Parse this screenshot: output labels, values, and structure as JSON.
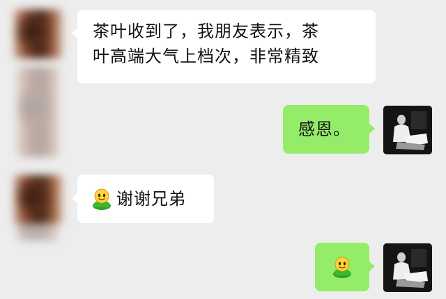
{
  "messages": [
    {
      "side": "left",
      "type": "text",
      "lines": [
        "茶叶收到了，我朋友表示，茶",
        "叶高端大气上档次，非常精致"
      ]
    },
    {
      "side": "right",
      "type": "text",
      "text": "感恩。"
    },
    {
      "side": "left",
      "type": "emoji_text",
      "emoji": "smiley-icon",
      "text": "谢谢兄弟"
    },
    {
      "side": "right",
      "type": "emoji",
      "emoji": "smiley-icon"
    }
  ],
  "colors": {
    "background": "#ededed",
    "incoming_bubble": "#ffffff",
    "outgoing_bubble": "#95ec69",
    "text": "#111111"
  }
}
